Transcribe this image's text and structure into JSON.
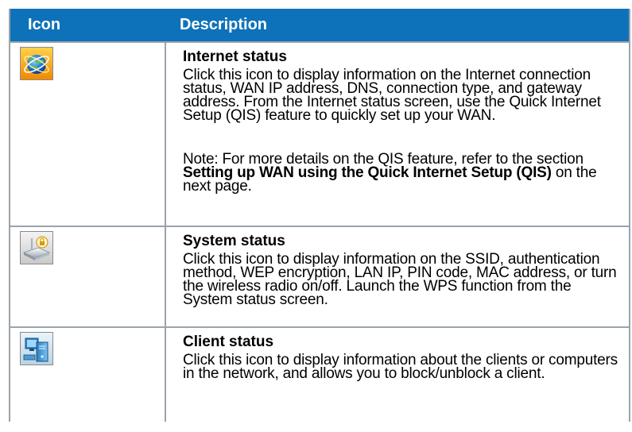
{
  "header": {
    "col_icon": "Icon",
    "col_description": "Description"
  },
  "rows": [
    {
      "icon": "internet-globe-icon",
      "title": "Internet status",
      "text": "Click this icon to display information on the Internet connection status, WAN IP address,  DNS, connection type, and gateway address.  From the Internet status screen, use the Quick Internet Setup (QIS) feature to quickly set up your WAN.",
      "note_prefix": "Note: For more details on the QIS feature, refer to the section ",
      "note_bold": "Setting up WAN using the Quick Internet Setup (QIS)",
      "note_suffix": " on the next page."
    },
    {
      "icon": "router-lock-icon",
      "title": "System status",
      "text": "Click this icon to display information on the SSID, authentication method, WEP encryption, LAN IP, PIN code, MAC address, or turn the wireless radio on/off. Launch the WPS function from the System status screen."
    },
    {
      "icon": "client-computer-icon",
      "title": "Client status",
      "text": "Click this icon to display information about the clients or computers in the network, and allows you to block/unblock a client."
    }
  ],
  "colors": {
    "header_bg": "#0e72ba",
    "header_text": "#ffffff",
    "border": "#9ba3ab"
  }
}
